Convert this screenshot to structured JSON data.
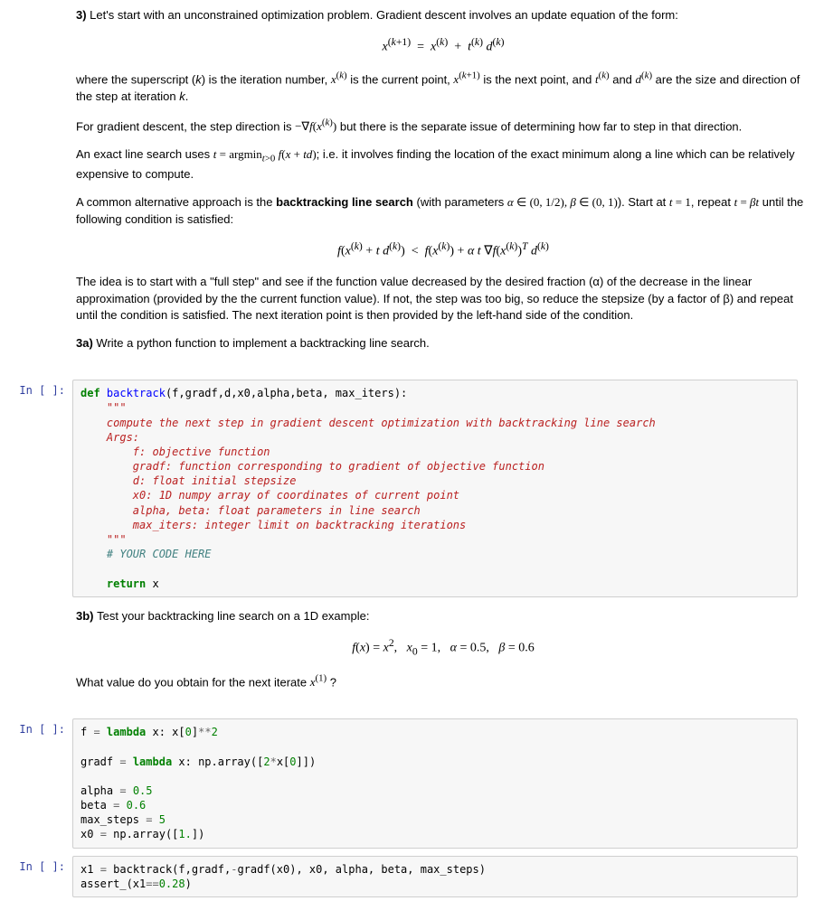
{
  "prompts": {
    "in_empty": "In [ ]:"
  },
  "md1": {
    "p1_prefix": "3) ",
    "p1": "Let's start with an unconstrained optimization problem. Gradient descent involves an update equation of the form:",
    "eq1": "x^(k+1) = x^(k) + t^(k) d^(k)",
    "p2": "where the superscript (k) is the iteration number, x^(k) is the current point, x^(k+1) is the next point, and t^(k) and d^(k) are the size and direction of the step at iteration k.",
    "p3": "For gradient descent, the step direction is −∇f(x^(k)) but there is the separate issue of determining how far to step in that direction.",
    "p4": "An exact line search uses t = argmin_{t>0} f(x + td); i.e. it involves finding the location of the exact minimum along a line which can be relatively expensive to compute.",
    "p5a": "A common alternative approach is the ",
    "p5b_bold": "backtracking line search",
    "p5c": " (with parameters α ∈ (0, 1/2), β ∈ (0, 1)). Start at t = 1, repeat t = βt until the following condition is satisfied:",
    "eq2": "f(x^(k) + t d^(k)) < f(x^(k)) + α t ∇f(x^(k))^T d^(k)",
    "p6": "The idea is to start with a \"full step\" and see if the function value decreased by the desired fraction (α) of the decrease in the linear approximation (provided by the the current function value). If not, the step was too big, so reduce the stepsize (by a factor of β) and repeat until the condition is satisfied. The next iteration point is then provided by the left-hand side of the condition.",
    "p7_prefix": "3a) ",
    "p7": "Write a python function to implement a backtracking line search."
  },
  "code1": {
    "def": "def",
    "fname": "backtrack",
    "sig": "(f,gradf,d,x0,alpha,beta, max_iters):",
    "doc_open": "\"\"\"",
    "doc_l1": "compute the next step in gradient descent optimization with backtracking line search",
    "doc_l2": "Args:",
    "doc_l3": "    f: objective function",
    "doc_l4": "    gradf: function corresponding to gradient of objective function",
    "doc_l5": "    d: float initial stepsize",
    "doc_l6": "    x0: 1D numpy array of coordinates of current point",
    "doc_l7": "    alpha, beta: float parameters in line search",
    "doc_l8": "    max_iters: integer limit on backtracking iterations",
    "doc_close": "\"\"\"",
    "comment": "# YOUR CODE HERE",
    "ret": "return",
    "retvar": " x"
  },
  "md2": {
    "p1_prefix": "3b) ",
    "p1": "Test your backtracking line search on a 1D example:",
    "eq": "f(x) = x²,  x₀ = 1,  α = 0.5,  β = 0.6",
    "p2": "What value do you obtain for the next iterate x^(1) ?"
  },
  "code2": {
    "l1_a": "f ",
    "l1_eq": "=",
    "l1_b": " ",
    "l1_lambda": "lambda",
    "l1_c": " x: x[",
    "l1_0": "0",
    "l1_d": "]",
    "l1_pow": "**",
    "l1_2": "2",
    "blank": "",
    "l2_a": "gradf ",
    "l2_eq": "=",
    "l2_b": " ",
    "l2_lambda": "lambda",
    "l2_c": " x: np.array([",
    "l2_2": "2",
    "l2_star": "*",
    "l2_d": "x[",
    "l2_0": "0",
    "l2_e": "]])",
    "l3_a": "alpha ",
    "l3_eq": "=",
    "l3_b": " ",
    "l3_v": "0.5",
    "l4_a": "beta ",
    "l4_eq": "=",
    "l4_b": " ",
    "l4_v": "0.6",
    "l5_a": "max_steps ",
    "l5_eq": "=",
    "l5_b": " ",
    "l5_v": "5",
    "l6_a": "x0 ",
    "l6_eq": "=",
    "l6_b": " np.array([",
    "l6_v": "1.",
    "l6_c": "])"
  },
  "code3": {
    "l1_a": "x1 ",
    "l1_eq": "=",
    "l1_b": " backtrack(f,gradf,",
    "l1_neg": "-",
    "l1_c": "gradf(x0), x0, alpha, beta, max_steps)",
    "l2_a": "assert_(x1",
    "l2_eq": "==",
    "l2_v": "0.28",
    "l2_b": ")"
  }
}
